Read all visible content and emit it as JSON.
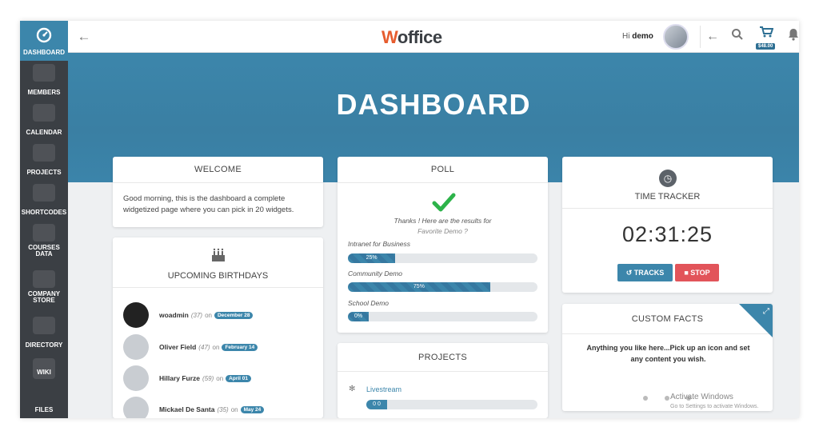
{
  "sidebar": {
    "items": [
      {
        "label": "DASHBOARD",
        "icon": "dashboard-icon",
        "active": true
      },
      {
        "label": "MEMBERS",
        "icon": "members-icon"
      },
      {
        "label": "CALENDAR",
        "icon": "calendar-icon"
      },
      {
        "label": "PROJECTS",
        "icon": "projects-icon"
      },
      {
        "label": "SHORTCODES",
        "icon": "shortcodes-icon"
      },
      {
        "label": "COURSES DATA",
        "icon": "courses-icon"
      },
      {
        "label": "COMPANY STORE",
        "icon": "store-icon"
      },
      {
        "label": "DIRECTORY",
        "icon": "directory-icon"
      },
      {
        "label": "WIKI",
        "icon": "wiki-icon"
      },
      {
        "label": "FILES",
        "icon": "files-icon"
      }
    ]
  },
  "topbar": {
    "logo_w": "W",
    "logo_rest": "office",
    "greeting": "Hi",
    "username": "demo",
    "cart_price": "$48.00"
  },
  "hero": {
    "title": "DASHBOARD"
  },
  "welcome": {
    "title": "WELCOME",
    "text": "Good morning, this is the dashboard a complete widgetized page where you can pick in 20 widgets."
  },
  "poll": {
    "title": "POLL",
    "thanks": "Thanks ! Here are the results for",
    "question": "Favorite Demo ?",
    "options": [
      {
        "label": "Intranet for Business",
        "percent": 25,
        "display": "25%"
      },
      {
        "label": "Community Demo",
        "percent": 75,
        "display": "75%"
      },
      {
        "label": "School Demo",
        "percent": 0,
        "display": "0%"
      }
    ]
  },
  "time_tracker": {
    "title": "TIME TRACKER",
    "time": "02:31:25",
    "tracks_label": "TRACKS",
    "stop_label": "STOP"
  },
  "birthdays": {
    "title": "UPCOMING BIRTHDAYS",
    "rows": [
      {
        "name": "woadmin",
        "age": "(37)",
        "on": "on",
        "date": "December 28"
      },
      {
        "name": "Oliver Field",
        "age": "(47)",
        "on": "on",
        "date": "February 14"
      },
      {
        "name": "Hillary Furze",
        "age": "(59)",
        "on": "on",
        "date": "April 01"
      },
      {
        "name": "Mickael De Santa",
        "age": "(35)",
        "on": "on",
        "date": "May 24"
      }
    ]
  },
  "projects": {
    "title": "PROJECTS",
    "item": "Livestream",
    "progress_label": "0 0"
  },
  "facts": {
    "title": "CUSTOM FACTS",
    "text": "Anything you like here...Pick up an icon and set any content you wish."
  },
  "watermark": {
    "line1": "Activate Windows",
    "line2": "Go to Settings to activate Windows."
  },
  "colors": {
    "accent": "#3c86ab",
    "sidebar": "#3b3f44",
    "stop": "#e2545a",
    "check": "#2db34a"
  }
}
